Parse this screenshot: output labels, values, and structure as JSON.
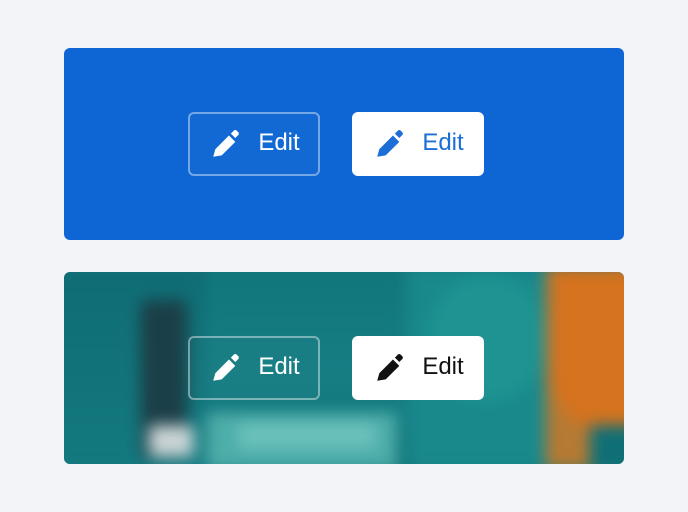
{
  "panels": [
    {
      "outline_button": {
        "label": "Edit",
        "icon": "pencil-icon",
        "text_color": "#ffffff"
      },
      "solid_button": {
        "label": "Edit",
        "icon": "pencil-icon",
        "text_color": "#1c6fd6"
      },
      "background_color": "#0e66d4"
    },
    {
      "outline_button": {
        "label": "Edit",
        "icon": "pencil-icon",
        "text_color": "#ffffff"
      },
      "solid_button": {
        "label": "Edit",
        "icon": "pencil-icon",
        "text_color": "#111111"
      },
      "background_color": "#15787e"
    }
  ]
}
